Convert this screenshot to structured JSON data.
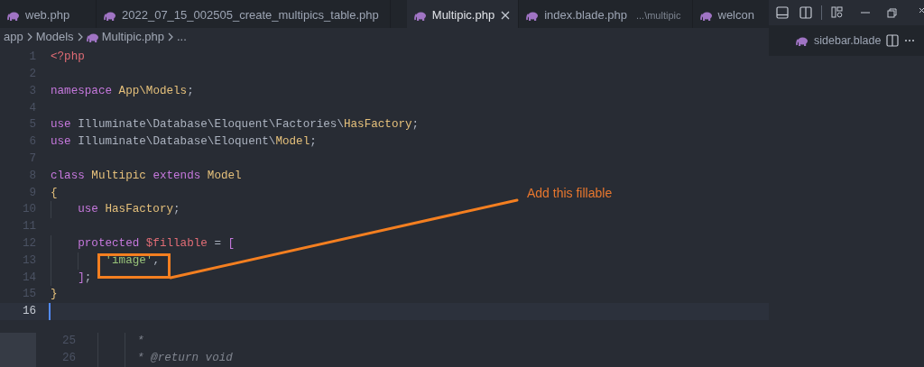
{
  "tabs": [
    {
      "label": "web.php",
      "selected": false
    },
    {
      "label": "2022_07_15_002505_create_multipics_table.php",
      "selected": false
    },
    {
      "label": "Multipic.php",
      "selected": true,
      "closable": true
    },
    {
      "label": "index.blade.php",
      "description": "...\\multipic",
      "selected": false
    },
    {
      "label": "welcon",
      "selected": false
    }
  ],
  "side_group": {
    "tab": {
      "label": "sidebar.blade"
    }
  },
  "breadcrumb": [
    {
      "text": "app",
      "kind": "folder"
    },
    {
      "text": "Models",
      "kind": "folder"
    },
    {
      "text": "Multipic.php",
      "kind": "file"
    },
    {
      "text": "...",
      "kind": "more"
    }
  ],
  "code": {
    "lines": [
      {
        "number": "1",
        "tokens": [
          {
            "kind": "tag",
            "text": "<?php"
          }
        ]
      },
      {
        "number": "2"
      },
      {
        "number": "3",
        "tokens": [
          {
            "kind": "keyword",
            "text": "namespace"
          },
          {
            "kind": "type",
            "text": " App\\Models"
          },
          {
            "kind": "plain",
            "text": ";"
          }
        ]
      },
      {
        "number": "4"
      },
      {
        "number": "5",
        "tokens": [
          {
            "kind": "keyword",
            "text": "use"
          },
          {
            "kind": "plain",
            "text": " Illuminate\\Database\\Eloquent\\Factories\\"
          },
          {
            "kind": "type",
            "text": "HasFactory"
          },
          {
            "kind": "plain",
            "text": ";"
          }
        ]
      },
      {
        "number": "6",
        "tokens": [
          {
            "kind": "keyword",
            "text": "use"
          },
          {
            "kind": "plain",
            "text": " Illuminate\\Database\\Eloquent\\"
          },
          {
            "kind": "type",
            "text": "Model"
          },
          {
            "kind": "plain",
            "text": ";"
          }
        ]
      },
      {
        "number": "7"
      },
      {
        "number": "8",
        "tokens": [
          {
            "kind": "keyword",
            "text": "class"
          },
          {
            "kind": "type",
            "text": " Multipic"
          },
          {
            "kind": "keyword",
            "text": " extends"
          },
          {
            "kind": "type",
            "text": " Model"
          }
        ]
      },
      {
        "number": "9",
        "tokens": [
          {
            "kind": "bracket1",
            "text": "{"
          }
        ]
      },
      {
        "number": "10",
        "tokens": [
          {
            "kind": "keyword",
            "text": "    use"
          },
          {
            "kind": "type",
            "text": " HasFactory"
          },
          {
            "kind": "plain",
            "text": ";"
          }
        ]
      },
      {
        "number": "11"
      },
      {
        "number": "12",
        "tokens": [
          {
            "kind": "keyword",
            "text": "    protected"
          },
          {
            "kind": "variable",
            "text": " $fillable"
          },
          {
            "kind": "plain",
            "text": " ="
          },
          {
            "kind": "bracket2",
            "text": " ["
          }
        ]
      },
      {
        "number": "13",
        "tokens": [
          {
            "kind": "string",
            "text": "        'image'"
          },
          {
            "kind": "plain",
            "text": ","
          }
        ]
      },
      {
        "number": "14",
        "tokens": [
          {
            "kind": "bracket2",
            "text": "    ]"
          },
          {
            "kind": "plain",
            "text": ";"
          }
        ]
      },
      {
        "number": "15",
        "tokens": [
          {
            "kind": "bracket1",
            "text": "}"
          }
        ]
      },
      {
        "number": "16",
        "current": true
      }
    ]
  },
  "peek": {
    "lines": [
      {
        "number": "25",
        "tokens": [
          {
            "kind": "comment",
            "text": "*"
          }
        ]
      },
      {
        "number": "26",
        "tokens": [
          {
            "kind": "comment",
            "text": "* @return void"
          }
        ]
      }
    ]
  },
  "annotation": {
    "text": "Add this fillable"
  }
}
